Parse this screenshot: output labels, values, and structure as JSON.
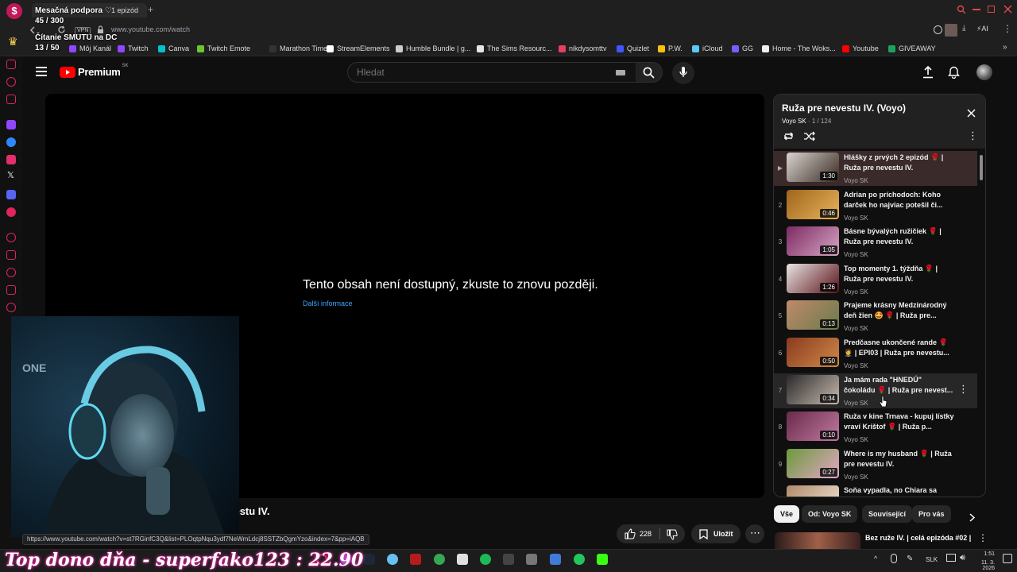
{
  "browser": {
    "tab_title": "1 epizód",
    "url": "www.youtube.com/watch",
    "vpn_badge": "VPN",
    "ai_label": "AI",
    "bookmarks": [
      {
        "label": "Môj Kanál",
        "color": "#9146ff"
      },
      {
        "label": "Twitch",
        "color": "#9146ff"
      },
      {
        "label": "Canva",
        "color": "#00c4cc"
      },
      {
        "label": "Twitch Emote",
        "color": "#6ec531"
      },
      {
        "label": "Marathon Timer",
        "color": "#333333"
      },
      {
        "label": "StreamElements",
        "color": "#ffffff"
      },
      {
        "label": "Humble Bundle | g...",
        "color": "#cccccc"
      },
      {
        "label": "The Sims Resourc...",
        "color": "#e6e6e6"
      },
      {
        "label": "nikdysomttv",
        "color": "#e4405f"
      },
      {
        "label": "Quizlet",
        "color": "#4255ff"
      },
      {
        "label": "P.W.",
        "color": "#f4c20d"
      },
      {
        "label": "iCloud",
        "color": "#5ac8fa"
      },
      {
        "label": "GG",
        "color": "#7b5cff"
      },
      {
        "label": "Home - The Woks...",
        "color": "#f0f0f0"
      },
      {
        "label": "Youtube",
        "color": "#ff0000"
      },
      {
        "label": "GIVEAWAY",
        "color": "#1aa260"
      }
    ]
  },
  "youtube": {
    "logo_text": "Premium",
    "logo_region": "SK",
    "search_placeholder": "Hledat",
    "player_error": "Tento obsah není dostupný, zkuste to znovu později.",
    "player_error_link": "Další informace",
    "video_title_fragment": "evestu IV.",
    "like_count": "228",
    "save_label": "Uložit",
    "status_url": "https://www.youtube.com/watch?v=st7RGinfC3Q&list=PLOqtpNqu3ydf7NeWmLdcj8SSTZbQgmYzo&index=7&pp=iAQB"
  },
  "playlist": {
    "title": "Ruža pre nevestu IV. (Voyo)",
    "channel": "Voyo SK",
    "position": "1 / 124",
    "items": [
      {
        "num": "▶",
        "title": "Hlášky z prvých 2 epizód 🌹 | Ruža pre nevestu IV.",
        "channel": "Voyo SK",
        "duration": "1:30",
        "c1": "#d8d4d0",
        "c2": "#3a2a22"
      },
      {
        "num": "2",
        "title": "Adrian po príchodoch: Koho darček ho najviac potešil či...",
        "channel": "Voyo SK",
        "duration": "0:46",
        "c1": "#a0651e",
        "c2": "#e7b45a"
      },
      {
        "num": "3",
        "title": "Básne bývalých ružičiek 🌹 | Ruža pre nevestu IV.",
        "channel": "Voyo SK",
        "duration": "1:05",
        "c1": "#7d2a62",
        "c2": "#d6a6c4"
      },
      {
        "num": "4",
        "title": "Top momenty 1. týždňa 🌹 | Ruža pre nevestu IV.",
        "channel": "Voyo SK",
        "duration": "1:26",
        "c1": "#e8e4e4",
        "c2": "#5a1218"
      },
      {
        "num": "5",
        "title": "Prajeme krásny Medzinárodný deň žien 🤩 🌹 | Ruža pre...",
        "channel": "Voyo SK",
        "duration": "0:13",
        "c1": "#c08a6c",
        "c2": "#6a7a4a"
      },
      {
        "num": "6",
        "title": "Predčasne ukončené rande 🌹 🤵 | EPI03 | Ruža pre nevestu...",
        "channel": "Voyo SK",
        "duration": "0:50",
        "c1": "#8a3a1e",
        "c2": "#d08a4a"
      },
      {
        "num": "7",
        "title": "Ja mám rada \"HNEDÚ\" čokoládu 🌹 | Ruža pre nevest...",
        "channel": "Voyo SK",
        "duration": "0:34",
        "c1": "#2a2a2a",
        "c2": "#c8bab0"
      },
      {
        "num": "8",
        "title": "Ruža v kine Trnava - kupuj lístky vraví Krištof 🌹 | Ruža p...",
        "channel": "Voyo SK",
        "duration": "0:10",
        "c1": "#6a2a4a",
        "c2": "#c07aa0"
      },
      {
        "num": "9",
        "title": "Where is my husband 🌹 | Ruža pre nevestu IV.",
        "channel": "Voyo SK",
        "duration": "0:27",
        "c1": "#6a9a3a",
        "c2": "#e6a6c8"
      },
      {
        "num": "",
        "title": "Soňa vypadla, no Chiara sa",
        "channel": "",
        "duration": "",
        "c1": "#b08a6a",
        "c2": "#f0e6d6"
      }
    ]
  },
  "chips": [
    "Vše",
    "Od: Voyo SK",
    "Související",
    "Pro vás"
  ],
  "next_video": {
    "title": "Bez ruže IV. | celá epizóda #02 |"
  },
  "overlay": {
    "support_label": "Mesačná podpora ♡",
    "support_count": "45 / 300",
    "smutu_label": "Čítanie SMUTU na DC",
    "smutu_count": "13 / 50",
    "top_donor": "Top dono dňa - superfako123 : 22.90"
  },
  "taskbar": {
    "lang": "SLK",
    "time": "1:51",
    "date": "11. 3. 2026"
  }
}
